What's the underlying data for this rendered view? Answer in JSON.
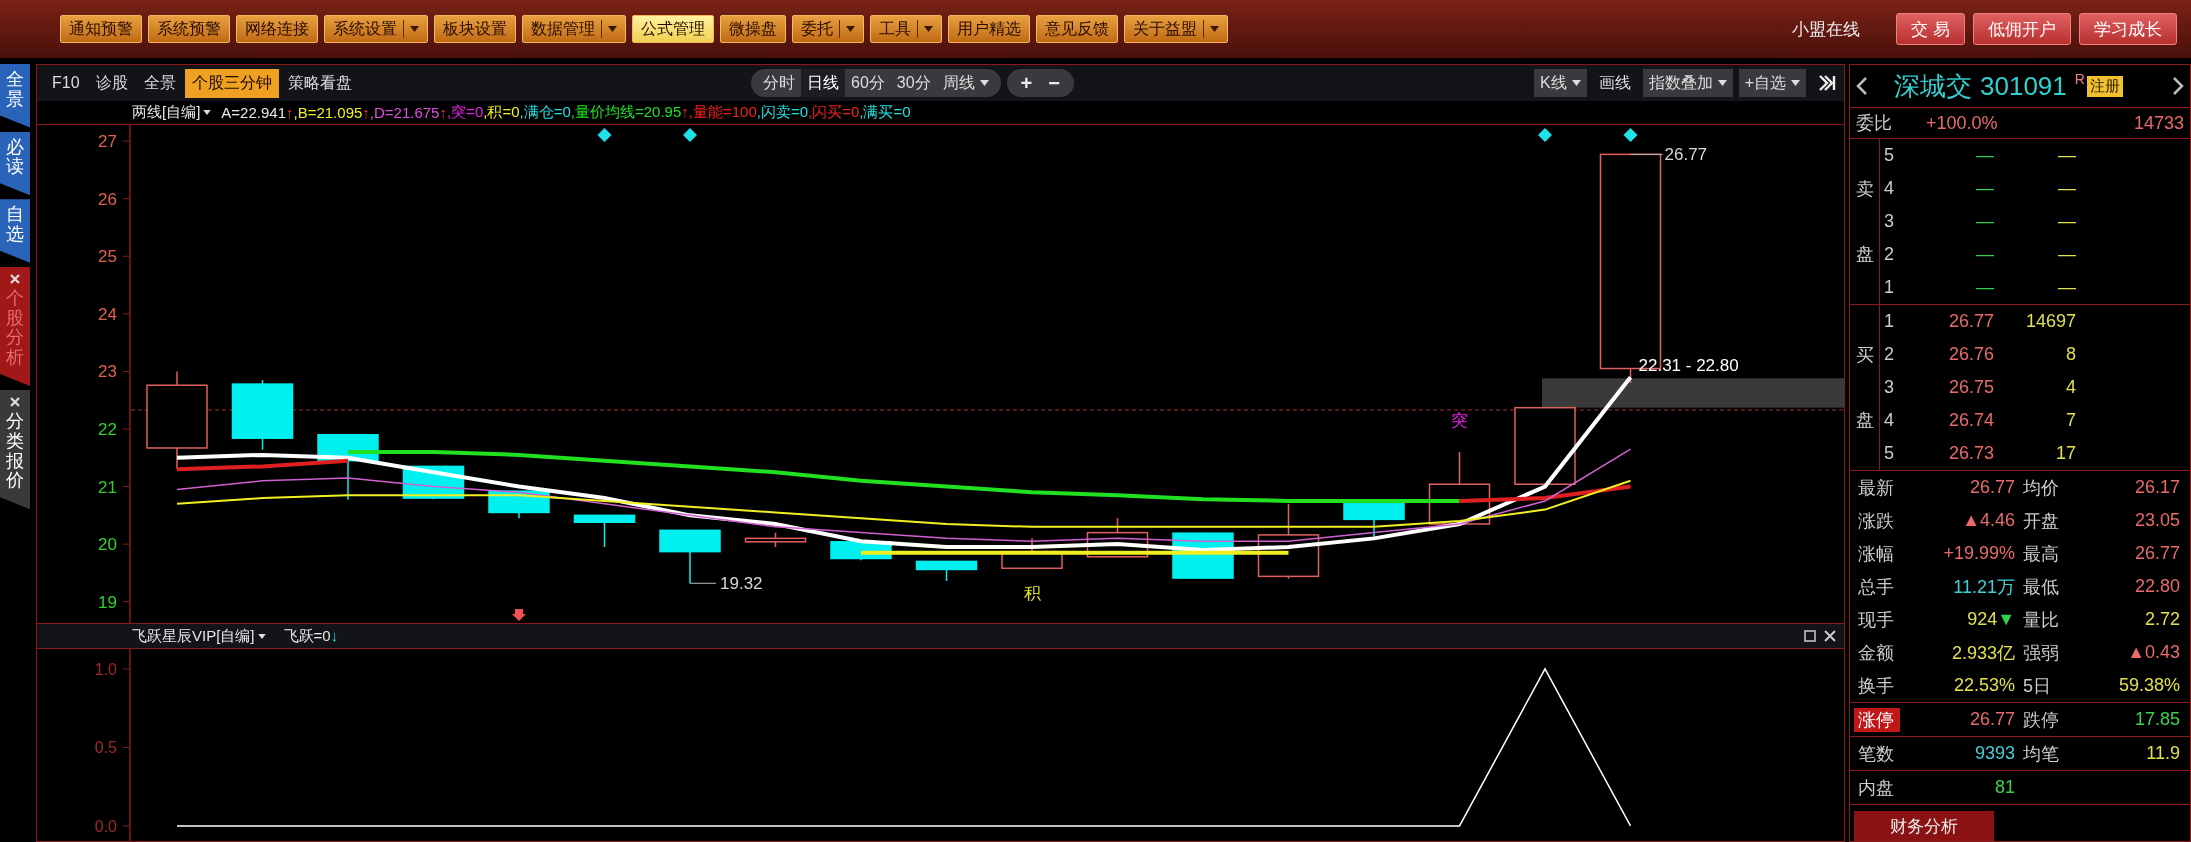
{
  "menu_bar": {
    "buttons": [
      {
        "label": "通知预警",
        "dropdown": false,
        "selected": false
      },
      {
        "label": "系统预警",
        "dropdown": false,
        "selected": false
      },
      {
        "label": "网络连接",
        "dropdown": false,
        "selected": false
      },
      {
        "label": "系统设置",
        "dropdown": true,
        "selected": false
      },
      {
        "label": "板块设置",
        "dropdown": false,
        "selected": false
      },
      {
        "label": "数据管理",
        "dropdown": true,
        "selected": false
      },
      {
        "label": "公式管理",
        "dropdown": false,
        "selected": true
      },
      {
        "label": "微操盘",
        "dropdown": false,
        "selected": false
      },
      {
        "label": "委托",
        "dropdown": true,
        "selected": false
      },
      {
        "label": "工具",
        "dropdown": true,
        "selected": false
      },
      {
        "label": "用户精选",
        "dropdown": false,
        "selected": false
      },
      {
        "label": "意见反馈",
        "dropdown": false,
        "selected": false
      },
      {
        "label": "关于益盟",
        "dropdown": true,
        "selected": false
      }
    ],
    "status": "小盟在线",
    "actions": [
      "交 易",
      "低佣开户",
      "学习成长"
    ]
  },
  "sidebar": {
    "tabs": [
      {
        "label": "全景",
        "closable": false,
        "selected": false
      },
      {
        "label": "必读",
        "closable": false,
        "selected": false
      },
      {
        "label": "自选",
        "closable": false,
        "selected": false
      },
      {
        "label": "个股分析",
        "closable": true,
        "selected": true
      },
      {
        "label": "分类报价",
        "closable": true,
        "selected": false
      }
    ]
  },
  "chart_toolbar": {
    "left_tabs": [
      {
        "label": "F10",
        "selected": false
      },
      {
        "label": "诊股",
        "selected": false
      },
      {
        "label": "全景",
        "selected": false
      },
      {
        "label": "个股三分钟",
        "selected": true
      },
      {
        "label": "策略看盘",
        "selected": false
      }
    ],
    "periods": [
      {
        "label": "分时",
        "dropdown": false,
        "selected": false
      },
      {
        "label": "日线",
        "dropdown": false,
        "selected": true
      },
      {
        "label": "60分",
        "dropdown": false,
        "selected": false
      },
      {
        "label": "30分",
        "dropdown": false,
        "selected": false
      },
      {
        "label": "周线",
        "dropdown": true,
        "selected": false
      }
    ],
    "zoom_buttons": [
      "+",
      "−"
    ],
    "right_tools": [
      {
        "label": "K线",
        "dropdown": true,
        "boxed": true
      },
      {
        "label": "画线",
        "dropdown": false,
        "boxed": false
      },
      {
        "label": "指数叠加",
        "dropdown": true,
        "boxed": true
      },
      {
        "label": "+自选",
        "dropdown": true,
        "boxed": true
      }
    ]
  },
  "main_indicator": {
    "name": "两线[自编]",
    "values": [
      {
        "text": "A=22.941",
        "color": "#e8e8e8",
        "arrow": "↑"
      },
      {
        "text": ",B=21.095",
        "color": "#f0f020",
        "arrow": "↑"
      },
      {
        "text": ",D=21.675",
        "color": "#e050e0",
        "arrow": "↑"
      },
      {
        "text": ",突=0",
        "color": "#e020e0"
      },
      {
        "text": ",积=0",
        "color": "#f0f020"
      },
      {
        "text": ",满仓=0",
        "color": "#20e0e0"
      },
      {
        "text": ",量价均线=20.95",
        "color": "#20e020",
        "arrow": "↑"
      },
      {
        "text": ",量能=100",
        "color": "#f02020"
      },
      {
        "text": ",闪卖=0",
        "color": "#20e0e0"
      },
      {
        "text": ",闪买=0",
        "color": "#f02020"
      },
      {
        "text": ",满买=0",
        "color": "#20e0e0"
      }
    ]
  },
  "price_chart": {
    "chart_data": {
      "type": "line",
      "ylim": [
        18.63,
        27.28
      ],
      "yticks": [
        19,
        20,
        21,
        22,
        23,
        24,
        25,
        26,
        27
      ],
      "series": [
        {
          "color": "#ffffff",
          "values": [
            21.5,
            21.55,
            21.5,
            21.25,
            21.0,
            20.8,
            20.5,
            20.35,
            20.05,
            19.95,
            19.95,
            20.0,
            19.9,
            19.95,
            20.1,
            20.35,
            21.0,
            22.9
          ]
        },
        {
          "color": "#e02020",
          "values": [
            21.3,
            21.35,
            21.45,
            null,
            null,
            null,
            null,
            null,
            null,
            null,
            null,
            null,
            null,
            null,
            null,
            null,
            null,
            null
          ]
        },
        {
          "color": "#20e020",
          "values": [
            null,
            null,
            21.6,
            21.6,
            21.55,
            21.45,
            21.35,
            21.25,
            21.1,
            21.0,
            20.9,
            20.85,
            20.78,
            20.75,
            20.75,
            20.75,
            null,
            null
          ]
        },
        {
          "color": "#e02020",
          "values": [
            null,
            null,
            null,
            null,
            null,
            null,
            null,
            null,
            null,
            null,
            null,
            null,
            null,
            null,
            null,
            20.75,
            20.8,
            21.0
          ]
        },
        {
          "color": "#d060d0",
          "values": [
            20.95,
            21.1,
            21.15,
            21.0,
            20.9,
            20.7,
            20.5,
            20.3,
            20.2,
            20.1,
            20.05,
            20.1,
            20.05,
            20.05,
            20.2,
            20.35,
            20.75,
            21.65
          ]
        },
        {
          "color": "#f0f020",
          "values": [
            20.7,
            20.8,
            20.85,
            20.85,
            20.85,
            20.75,
            20.65,
            20.55,
            20.45,
            20.35,
            20.3,
            20.3,
            20.3,
            20.3,
            20.3,
            20.4,
            20.6,
            21.1
          ]
        },
        {
          "color": "#f0f020",
          "values": [
            null,
            null,
            null,
            null,
            null,
            null,
            null,
            null,
            19.85,
            19.85,
            19.85,
            19.85,
            19.85,
            19.85,
            null,
            null,
            null,
            null
          ]
        }
      ]
    },
    "high_label": "26.77",
    "range_label": "22.31 - 22.80",
    "low_label": "19.32",
    "breakout_signal": "突",
    "accumulate_signal": "积"
  },
  "sub_indicator": {
    "name": "飞跃星辰VIP[自编]",
    "value": "飞跃=0",
    "arrow": "↓",
    "chart_data": {
      "type": "line",
      "ylim": [
        -0.096,
        1.127
      ],
      "yticks": [
        {
          "value": 1,
          "label": "1.0"
        },
        {
          "value": 0.5,
          "label": "0.5"
        },
        {
          "value": 0,
          "label": "0.0"
        }
      ],
      "series": [
        {
          "color": "#ffffff",
          "values": [
            0,
            0,
            0,
            0,
            0,
            0,
            0,
            0,
            0,
            0,
            0,
            0,
            0,
            0,
            0,
            0,
            1,
            0
          ]
        }
      ]
    }
  },
  "quote": {
    "name": "深城交",
    "code": "301091",
    "mark": "R",
    "badge": "注册",
    "order_ratio": {
      "label": "委比",
      "value": "+100.0%",
      "diff": "14733"
    },
    "sell_side": "卖盘",
    "sells": [
      {
        "level": "5",
        "price": "—",
        "volume": "—"
      },
      {
        "level": "4",
        "price": "—",
        "volume": "—"
      },
      {
        "level": "3",
        "price": "—",
        "volume": "—"
      },
      {
        "level": "2",
        "price": "—",
        "volume": "—"
      },
      {
        "level": "1",
        "price": "—",
        "volume": "—"
      }
    ],
    "buy_side": "买盘",
    "buys": [
      {
        "level": "1",
        "price": "26.77",
        "volume": "14697"
      },
      {
        "level": "2",
        "price": "26.76",
        "volume": "8"
      },
      {
        "level": "3",
        "price": "26.75",
        "volume": "4"
      },
      {
        "level": "4",
        "price": "26.74",
        "volume": "7"
      },
      {
        "level": "5",
        "price": "26.73",
        "volume": "17"
      }
    ],
    "sections": [
      {
        "cells": [
          {
            "label": "最新",
            "value": "26.77",
            "color": "#e86a6a",
            "highlighted": false
          },
          {
            "label": "均价",
            "value": "26.17",
            "color": "#e86a6a",
            "highlighted": false
          },
          {
            "label": "涨跌",
            "value": "▲4.46",
            "color": "#e86a6a",
            "highlighted": false
          },
          {
            "label": "开盘",
            "value": "23.05",
            "color": "#e86a6a",
            "highlighted": false
          },
          {
            "label": "涨幅",
            "value": "+19.99%",
            "color": "#e86a6a",
            "highlighted": false
          },
          {
            "label": "最高",
            "value": "26.77",
            "color": "#e86a6a",
            "highlighted": false
          },
          {
            "label": "总手",
            "value": "11.21万",
            "color": "#40d0d8",
            "highlighted": false
          },
          {
            "label": "最低",
            "value": "22.80",
            "color": "#e86a6a",
            "highlighted": false
          },
          {
            "label": "现手",
            "value": "924",
            "suffix": "▼",
            "color": "#e0e050",
            "highlighted": false
          },
          {
            "label": "量比",
            "value": "2.72",
            "color": "#e0e050",
            "highlighted": false
          },
          {
            "label": "金额",
            "value": "2.933亿",
            "color": "#e0e050",
            "highlighted": false
          },
          {
            "label": "强弱",
            "value": "▲0.43",
            "color": "#e86a6a",
            "highlighted": false
          },
          {
            "label": "换手",
            "value": "22.53%",
            "color": "#e0e050",
            "highlighted": false
          },
          {
            "label": "5日",
            "value": "59.38%",
            "color": "#e0e050",
            "highlighted": false
          }
        ]
      },
      {
        "cells": [
          {
            "label": "涨停",
            "value": "26.77",
            "color": "#e86a6a",
            "highlighted": true
          },
          {
            "label": "跌停",
            "value": "17.85",
            "color": "#40d050",
            "highlighted": false
          }
        ]
      },
      {
        "cells": [
          {
            "label": "笔数",
            "value": "9393",
            "color": "#40d0d8",
            "highlighted": false
          },
          {
            "label": "均笔",
            "value": "11.9",
            "color": "#e0e050",
            "highlighted": false
          }
        ]
      },
      {
        "cells": [
          {
            "label": "内盘",
            "value": "81",
            "color": "#40d050",
            "highlighted": false
          }
        ]
      }
    ],
    "footer_button": "财务分析"
  }
}
